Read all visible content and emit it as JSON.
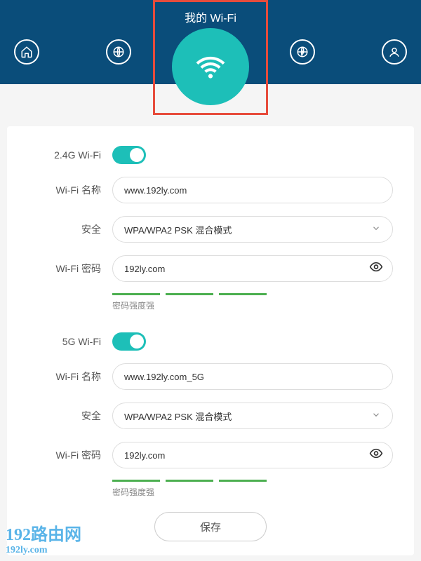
{
  "header": {
    "title": "我的 Wi-Fi"
  },
  "wifi_24g": {
    "toggle_label": "2.4G Wi-Fi",
    "enabled": true,
    "name_label": "Wi-Fi 名称",
    "name_value": "www.192ly.com",
    "security_label": "安全",
    "security_value": "WPA/WPA2 PSK 混合模式",
    "password_label": "Wi-Fi 密码",
    "password_value": "192ly.com",
    "strength_label": "密码强度强"
  },
  "wifi_5g": {
    "toggle_label": "5G Wi-Fi",
    "enabled": true,
    "name_label": "Wi-Fi 名称",
    "name_value": "www.192ly.com_5G",
    "security_label": "安全",
    "security_value": "WPA/WPA2 PSK 混合模式",
    "password_label": "Wi-Fi 密码",
    "password_value": "192ly.com",
    "strength_label": "密码强度强"
  },
  "actions": {
    "save_label": "保存"
  },
  "watermark": {
    "line1": "192路由网",
    "line2": "192ly.com"
  }
}
